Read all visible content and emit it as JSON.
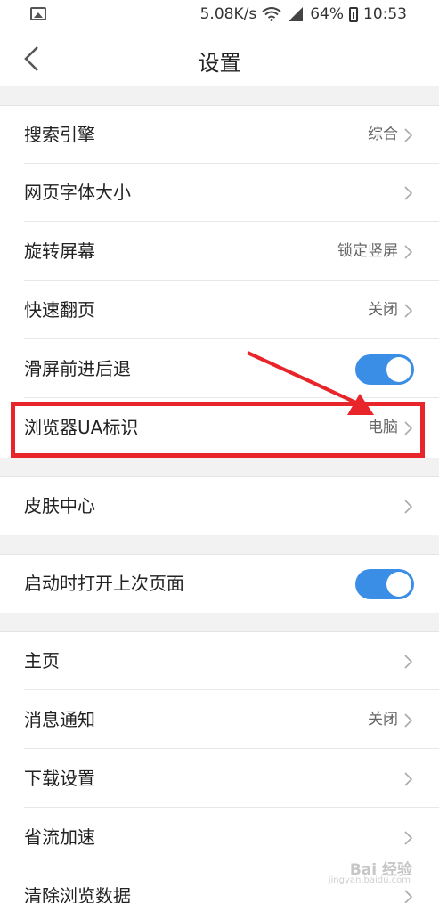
{
  "status_bar": {
    "net_speed": "5.08K/s",
    "battery_pct": "64%",
    "time": "10:53"
  },
  "header": {
    "title": "设置"
  },
  "groups": [
    {
      "items": [
        {
          "label": "搜索引擎",
          "value": "综合",
          "type": "link"
        },
        {
          "label": "网页字体大小",
          "value": "",
          "type": "link"
        },
        {
          "label": "旋转屏幕",
          "value": "锁定竖屏",
          "type": "link"
        },
        {
          "label": "快速翻页",
          "value": "关闭",
          "type": "link"
        },
        {
          "label": "滑屏前进后退",
          "type": "toggle",
          "on": true
        },
        {
          "label": "浏览器UA标识",
          "value": "电脑",
          "type": "link"
        }
      ]
    },
    {
      "items": [
        {
          "label": "皮肤中心",
          "value": "",
          "type": "link"
        }
      ]
    },
    {
      "items": [
        {
          "label": "启动时打开上次页面",
          "type": "toggle",
          "on": true
        }
      ]
    },
    {
      "items": [
        {
          "label": "主页",
          "value": "",
          "type": "link"
        },
        {
          "label": "消息通知",
          "value": "关闭",
          "type": "link"
        },
        {
          "label": "下载设置",
          "value": "",
          "type": "link"
        },
        {
          "label": "省流加速",
          "value": "",
          "type": "link"
        },
        {
          "label": "清除浏览数据",
          "value": "",
          "type": "link"
        }
      ]
    }
  ],
  "annotation": {
    "highlight_color": "#e8252b"
  },
  "watermark": {
    "text": "Bai 经验",
    "sub": "jingyan.baidu.com"
  },
  "colors": {
    "toggle_on": "#3a8ee6",
    "section_gap": "#f2f2f2"
  }
}
